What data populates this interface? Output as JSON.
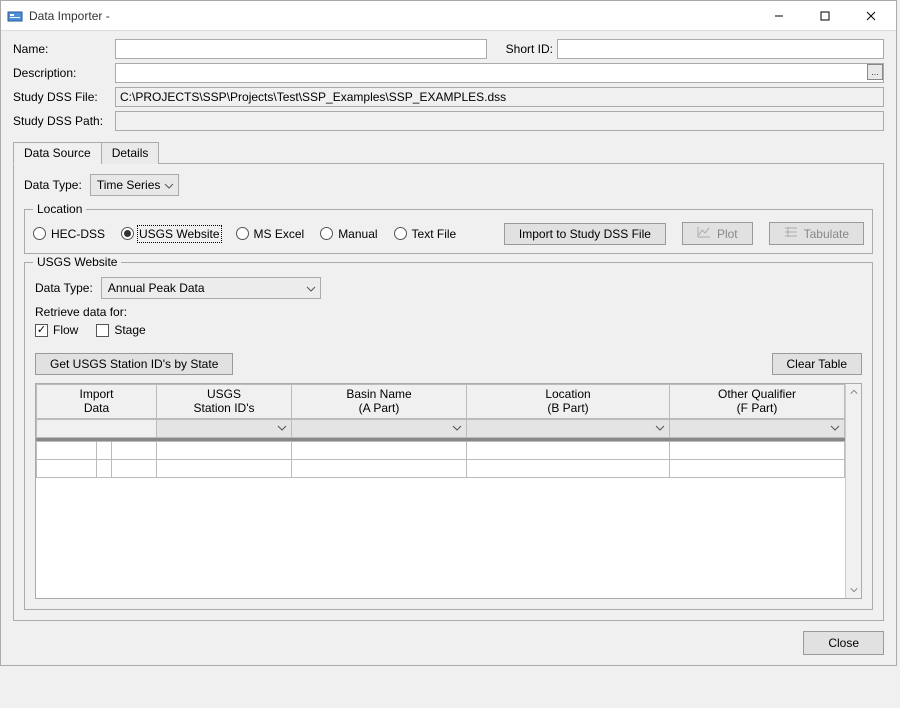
{
  "window": {
    "title": "Data Importer -"
  },
  "form": {
    "name_label": "Name:",
    "name_value": "",
    "shortid_label": "Short ID:",
    "shortid_value": "",
    "description_label": "Description:",
    "description_value": "",
    "dssfile_label": "Study DSS File:",
    "dssfile_value": "C:\\PROJECTS\\SSP\\Projects\\Test\\SSP_Examples\\SSP_EXAMPLES.dss",
    "dsspath_label": "Study DSS Path:",
    "dsspath_value": ""
  },
  "tabs": {
    "data_source": "Data Source",
    "details": "Details"
  },
  "data_type": {
    "label": "Data Type:",
    "value": "Time Series"
  },
  "location": {
    "legend": "Location",
    "options": {
      "hec_dss": "HEC-DSS",
      "usgs": "USGS Website",
      "ms_excel": "MS Excel",
      "manual": "Manual",
      "text_file": "Text File"
    },
    "selected": "usgs"
  },
  "buttons": {
    "import_study": "Import to Study DSS File",
    "plot": "Plot",
    "tabulate": "Tabulate",
    "get_usgs": "Get USGS Station ID's by State",
    "clear_table": "Clear Table",
    "close": "Close"
  },
  "usgs": {
    "group_label": "USGS Website",
    "datatype_label": "Data Type:",
    "datatype_value": "Annual Peak Data",
    "retrieve_label": "Retrieve data for:",
    "flow_label": "Flow",
    "stage_label": "Stage"
  },
  "table": {
    "cols": {
      "import": {
        "l1": "Import",
        "l2": "Data"
      },
      "usgs": {
        "l1": "USGS",
        "l2": "Station ID's"
      },
      "basin": {
        "l1": "Basin Name",
        "l2": "(A Part)"
      },
      "loc": {
        "l1": "Location",
        "l2": "(B Part)"
      },
      "other": {
        "l1": "Other Qualifier",
        "l2": "(F Part)"
      }
    }
  }
}
